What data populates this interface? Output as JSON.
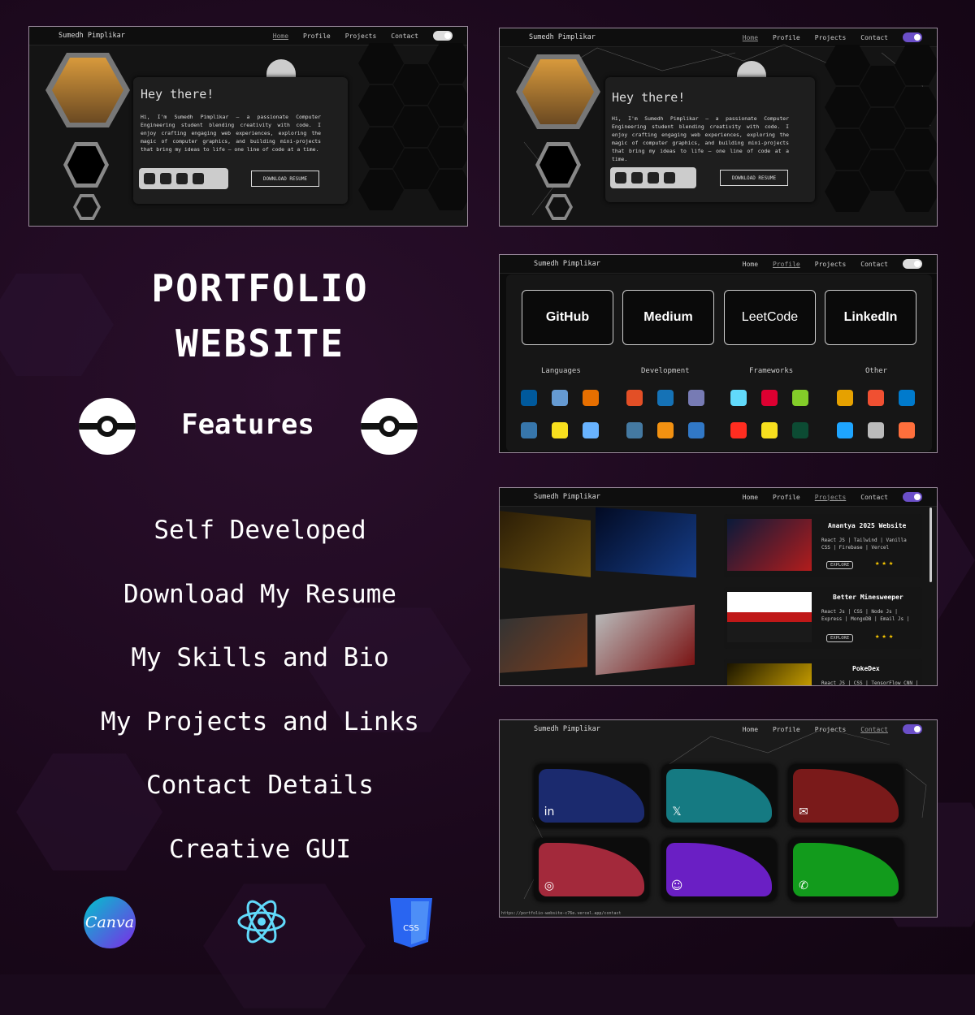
{
  "left_panel": {
    "title_line1": "PORTFOLIO",
    "title_line2": "WEBSITE",
    "features_heading": "Features",
    "features": [
      "Self Developed",
      "Download My Resume",
      "My Skills and Bio",
      "My Projects and Links",
      "Contact Details",
      "Creative GUI"
    ],
    "tool_icons": [
      {
        "name": "canva-logo",
        "label": "Canva",
        "color": "#7d2ae8"
      },
      {
        "name": "react-logo",
        "color": "#61dafb"
      },
      {
        "name": "css3-logo",
        "label": "CSS",
        "color": "#2965f1"
      }
    ]
  },
  "nav": {
    "brand": "Sumedh Pimplikar",
    "links": [
      "Home",
      "Profile",
      "Projects",
      "Contact"
    ]
  },
  "home": {
    "greeting": "Hey there!",
    "bio": "Hi, I'm Sumedh Pimplikar – a passionate Computer Engineering student blending creativity with code. I enjoy crafting engaging web experiences, exploring the magic of computer graphics, and building mini-projects that bring my ideas to life – one line of code at a time.",
    "download_label": "DOWNLOAD RESUME"
  },
  "profile": {
    "platforms": [
      {
        "label": "GitHub",
        "icon": "github-icon"
      },
      {
        "label": "Medium",
        "icon": "medium-icon"
      },
      {
        "label": "LeetCode",
        "icon": "leetcode-icon"
      },
      {
        "label": "LinkedIn",
        "icon": "linkedin-icon"
      }
    ],
    "categories": [
      "Languages",
      "Development",
      "Frameworks",
      "Other"
    ],
    "skill_colors": {
      "Languages": [
        "#00599c",
        "#659ad2",
        "#e76f00",
        "#3776ab",
        "#f7df1e",
        "#68b3ff"
      ],
      "Development": [
        "#e34f26",
        "#1572b6",
        "#777bb4",
        "#4479a1",
        "#f29111",
        "#3178c6"
      ],
      "Frameworks": [
        "#61dafb",
        "#dd0031",
        "#83cd29",
        "#ff2d20",
        "#f7df1e",
        "#0c4b33"
      ],
      "Other": [
        "#e6a100",
        "#f05032",
        "#007acc",
        "#1ea5ff",
        "#bbbbbb",
        "#ff6f3c"
      ]
    }
  },
  "projects": [
    {
      "title": "Anantya 2025 Website",
      "tech": "React JS | Tailwind | Vanilla CSS | Firebase | Vercel",
      "button": "EXPLORE",
      "stars": "★★★"
    },
    {
      "title": "Better Minesweeper",
      "tech": "React Js | CSS | Node Js | Express | MongoDB | Email Js |",
      "button": "EXPLORE",
      "stars": "★★★"
    },
    {
      "title": "PokeDex",
      "tech": "React JS | CSS | TensorFlow CNN |",
      "button": "",
      "stars": ""
    }
  ],
  "contact": {
    "cards": [
      {
        "icon": "linkedin-icon",
        "glyph": "in",
        "color": "#1b2a6e"
      },
      {
        "icon": "x-icon",
        "glyph": "𝕏",
        "color": "#157a82"
      },
      {
        "icon": "mail-icon",
        "glyph": "✉",
        "color": "#7a1a1a"
      },
      {
        "icon": "instagram-icon",
        "glyph": "◎",
        "color": "#a3293b"
      },
      {
        "icon": "discord-icon",
        "glyph": "☺",
        "color": "#6a1fc4"
      },
      {
        "icon": "whatsapp-icon",
        "glyph": "✆",
        "color": "#129b1c"
      }
    ],
    "status_url": "https://portfolio-website-c76e.vercel.app/contact"
  }
}
